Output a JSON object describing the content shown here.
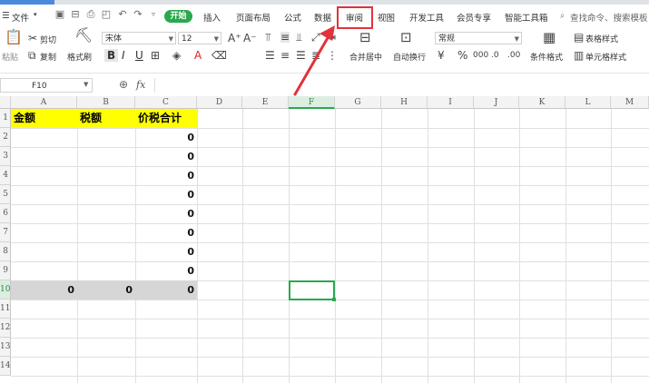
{
  "menu": {
    "file_label": "文件",
    "tabs": [
      "开始",
      "插入",
      "页面布局",
      "公式",
      "数据",
      "审阅",
      "视图",
      "开发工具",
      "会员专享",
      "智能工具箱"
    ],
    "search_label": "查找命令、搜索模板"
  },
  "ribbon": {
    "paste_label": "粘贴",
    "cut_label": "剪切",
    "copy_label": "复制",
    "format_painter_label": "格式刷",
    "font_name": "宋体",
    "font_size": "12",
    "bold": "B",
    "italic": "I",
    "underline": "U",
    "merge_label": "合并居中",
    "wrap_label": "自动换行",
    "number_format": "常规",
    "table_style_label": "表格样式",
    "cond_format_label": "条件格式",
    "cell_style_label": "单元格样式"
  },
  "formula_bar": {
    "name_box": "F10",
    "fx": "fx"
  },
  "sheet": {
    "columns": [
      "A",
      "B",
      "C",
      "D",
      "E",
      "F",
      "G",
      "H",
      "I",
      "J",
      "K",
      "L",
      "M"
    ],
    "rows": [
      "1",
      "2",
      "3",
      "4",
      "5",
      "6",
      "7",
      "8",
      "9",
      "10",
      "11",
      "12",
      "13",
      "14"
    ],
    "selected_cell": "F10",
    "header_row": [
      "金额",
      "税额",
      "价税合计"
    ],
    "c_values": [
      "0",
      "0",
      "0",
      "0",
      "0",
      "0",
      "0",
      "0"
    ],
    "total_row": [
      "0",
      "0",
      "0"
    ]
  },
  "colors": {
    "accent_green": "#2aa84f",
    "header_fill": "#ffff00",
    "annotation_red": "#e0333b"
  }
}
